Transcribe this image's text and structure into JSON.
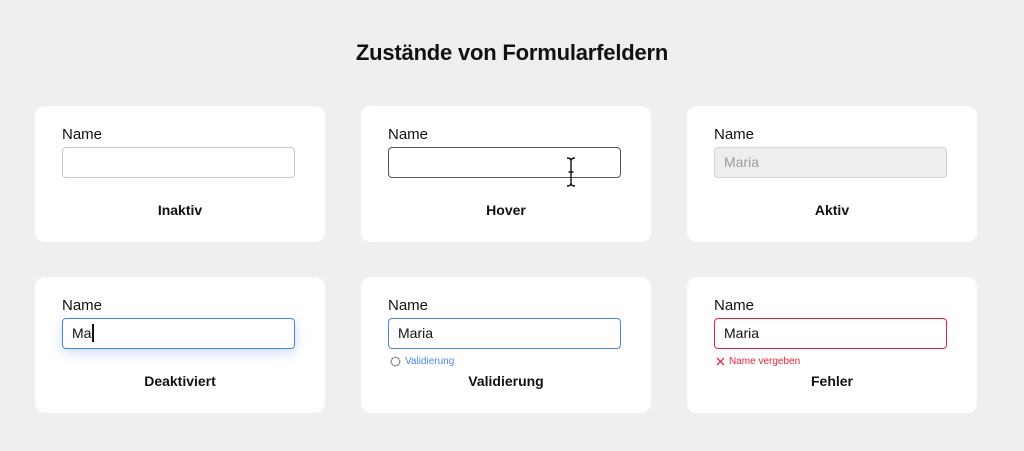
{
  "page": {
    "title": "Zustände von Formularfeldern"
  },
  "colors": {
    "background": "#efefef",
    "focus_blue": "#4a86e8",
    "error_red": "#e0253a",
    "disabled_bg": "#eeeeee"
  },
  "cards": [
    {
      "label": "Name",
      "value": "",
      "state": "Inaktiv"
    },
    {
      "label": "Name",
      "value": "",
      "state": "Hover",
      "icon": "text-cursor-icon"
    },
    {
      "label": "Name",
      "value": "Maria",
      "state": "Aktiv"
    },
    {
      "label": "Name",
      "value": "Ma",
      "state": "Deaktiviert"
    },
    {
      "label": "Name",
      "value": "Maria",
      "state": "Validierung",
      "hint": "Validierung",
      "hint_icon": "spinner-icon"
    },
    {
      "label": "Name",
      "value": "Maria",
      "state": "Fehler",
      "hint": "Name vergeben",
      "hint_icon": "error-x-icon"
    }
  ]
}
